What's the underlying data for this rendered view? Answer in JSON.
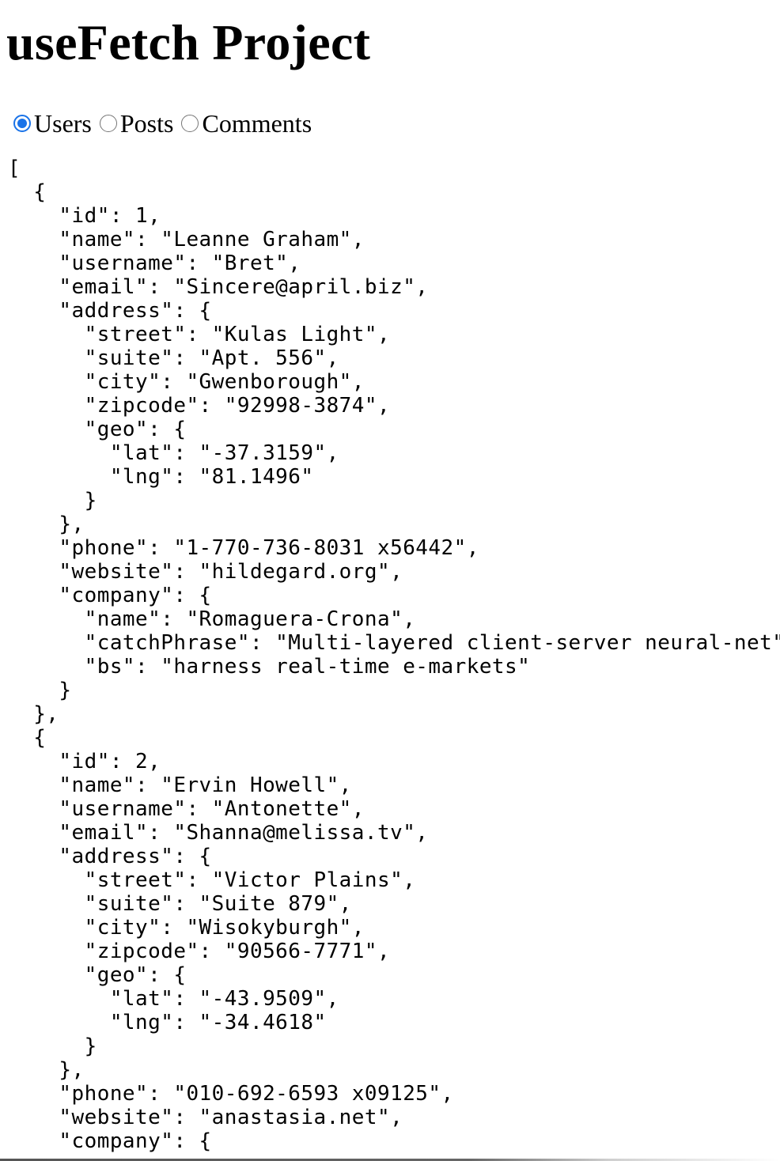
{
  "page": {
    "title": "useFetch Project"
  },
  "resource_selector": {
    "options": [
      {
        "label": "Users",
        "checked": true
      },
      {
        "label": "Posts",
        "checked": false
      },
      {
        "label": "Comments",
        "checked": false
      }
    ],
    "accent_color": "#1a73e8"
  },
  "json_output": [
    "[",
    "  {",
    "    \"id\": 1,",
    "    \"name\": \"Leanne Graham\",",
    "    \"username\": \"Bret\",",
    "    \"email\": \"Sincere@april.biz\",",
    "    \"address\": {",
    "      \"street\": \"Kulas Light\",",
    "      \"suite\": \"Apt. 556\",",
    "      \"city\": \"Gwenborough\",",
    "      \"zipcode\": \"92998-3874\",",
    "      \"geo\": {",
    "        \"lat\": \"-37.3159\",",
    "        \"lng\": \"81.1496\"",
    "      }",
    "    },",
    "    \"phone\": \"1-770-736-8031 x56442\",",
    "    \"website\": \"hildegard.org\",",
    "    \"company\": {",
    "      \"name\": \"Romaguera-Crona\",",
    "      \"catchPhrase\": \"Multi-layered client-server neural-net\",",
    "      \"bs\": \"harness real-time e-markets\"",
    "    }",
    "  },",
    "  {",
    "    \"id\": 2,",
    "    \"name\": \"Ervin Howell\",",
    "    \"username\": \"Antonette\",",
    "    \"email\": \"Shanna@melissa.tv\",",
    "    \"address\": {",
    "      \"street\": \"Victor Plains\",",
    "      \"suite\": \"Suite 879\",",
    "      \"city\": \"Wisokyburgh\",",
    "      \"zipcode\": \"90566-7771\",",
    "      \"geo\": {",
    "        \"lat\": \"-43.9509\",",
    "        \"lng\": \"-34.4618\"",
    "      }",
    "    },",
    "    \"phone\": \"010-692-6593 x09125\",",
    "    \"website\": \"anastasia.net\",",
    "    \"company\": {"
  ]
}
